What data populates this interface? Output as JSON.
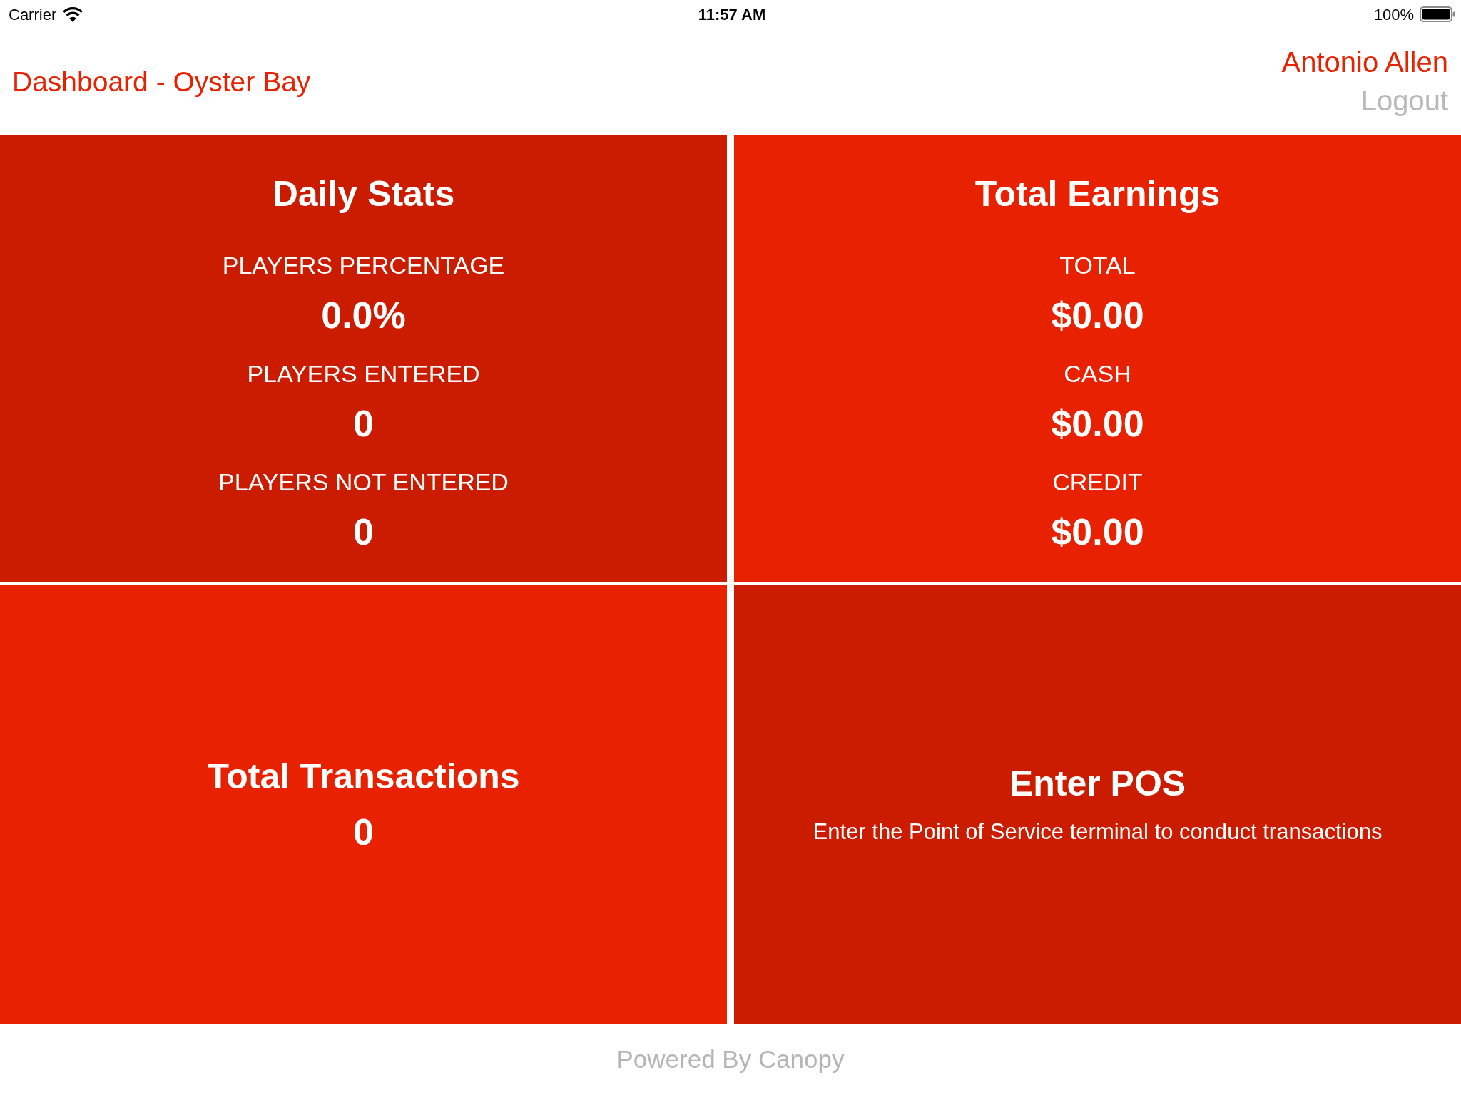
{
  "status_bar": {
    "carrier": "Carrier",
    "time": "11:57 AM",
    "battery": "100%"
  },
  "header": {
    "title": "Dashboard - Oyster Bay",
    "user": "Antonio Allen",
    "logout": "Logout"
  },
  "tiles": [
    {
      "kind": "stats",
      "color": "#cc1c00",
      "title": "Daily Stats",
      "stats": [
        {
          "label": "PLAYERS PERCENTAGE",
          "value": "0.0%"
        },
        {
          "label": "PLAYERS ENTERED",
          "value": "0"
        },
        {
          "label": "PLAYERS NOT ENTERED",
          "value": "0"
        }
      ]
    },
    {
      "kind": "stats",
      "color": "#e82100",
      "title": "Total Earnings",
      "stats": [
        {
          "label": "TOTAL",
          "value": "$0.00"
        },
        {
          "label": "CASH",
          "value": "$0.00"
        },
        {
          "label": "CREDIT",
          "value": "$0.00"
        }
      ]
    },
    {
      "kind": "summary",
      "color": "#e82100",
      "title": "Total Transactions",
      "value": "0"
    },
    {
      "kind": "action",
      "color": "#cc1c00",
      "title": "Enter POS",
      "description": "Enter the Point of Service terminal to conduct transactions"
    }
  ],
  "footer": "Powered By Canopy"
}
